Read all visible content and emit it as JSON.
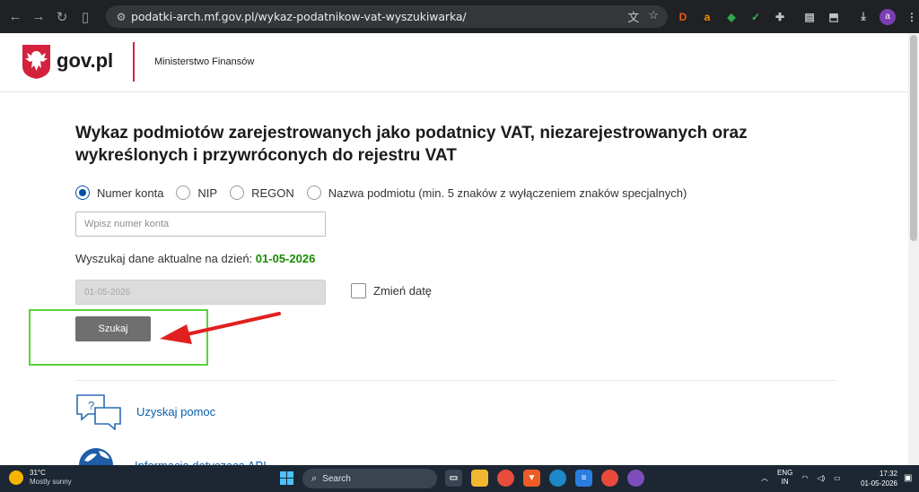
{
  "browser": {
    "url": "podatki-arch.mf.gov.pl/wykaz-podatnikow-vat-wyszukiwarka/",
    "avatar_letter": "a",
    "extensions": [
      {
        "name": "D-extension",
        "glyph": "D",
        "color": "#e8590c"
      },
      {
        "name": "amazon-extension",
        "glyph": "a",
        "color": "#f29100"
      },
      {
        "name": "shield-extension",
        "glyph": "◆",
        "color": "#2fa84f"
      },
      {
        "name": "check-extension",
        "glyph": "✓",
        "color": "#2fbf4f"
      }
    ]
  },
  "header": {
    "logo_text": "gov.pl",
    "ministry": "Ministerstwo Finansów",
    "accent_color": "#d4213d"
  },
  "main": {
    "title": "Wykaz podmiotów zarejestrowanych jako podatnicy VAT, niezarejestrowanych oraz wykreślonych i przywróconych do rejestru VAT",
    "radio_options": [
      {
        "label": "Numer konta",
        "checked": true
      },
      {
        "label": "NIP",
        "checked": false
      },
      {
        "label": "REGON",
        "checked": false
      },
      {
        "label": "Nazwa podmiotu (min. 5 znaków z wyłączeniem znaków specjalnych)",
        "checked": false
      }
    ],
    "account_placeholder": "Wpisz numer konta",
    "date_label": "Wyszukaj dane aktualne na dzień:",
    "date_value": "01-05-2026",
    "date_input_value": "01-05-2026",
    "change_date_label": "Zmień datę",
    "search_button": "Szukaj",
    "help_link": "Uzyskaj pomoc",
    "api_link": "Informacja dotycząca API"
  },
  "taskbar": {
    "temperature": "31°C",
    "condition": "Mostly sunny",
    "search_label": "Search",
    "lang_top": "ENG",
    "lang_bottom": "IN",
    "time": "17:32",
    "date": "01-05-2026"
  }
}
